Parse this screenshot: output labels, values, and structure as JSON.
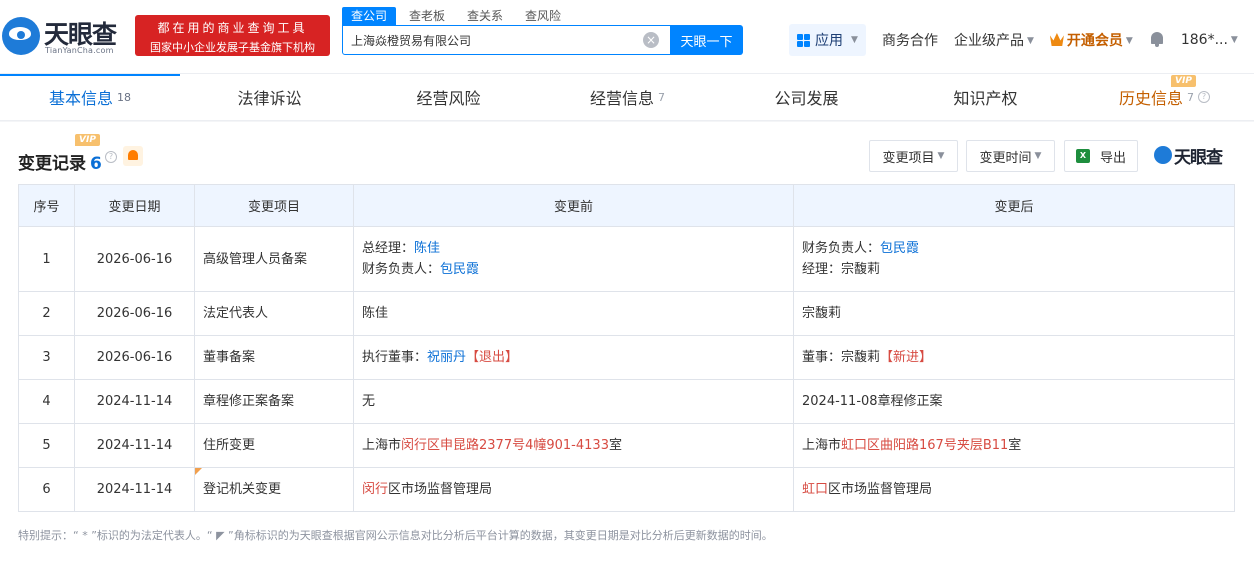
{
  "header": {
    "logo_name": "天眼查",
    "logo_domain": "TianYanCha.com",
    "slogan_line1": "都在用的商业查询工具",
    "slogan_line2": "国家中小企业发展子基金旗下机构",
    "search_tabs": [
      "查公司",
      "查老板",
      "查关系",
      "查风险"
    ],
    "search_value": "上海焱橙贸易有限公司",
    "search_button": "天眼一下",
    "nav": {
      "apps": "应用",
      "business": "商务合作",
      "enterprise": "企业级产品",
      "vip": "开通会员",
      "user": "186*..."
    }
  },
  "tabs": [
    {
      "label": "基本信息",
      "count": "18"
    },
    {
      "label": "法律诉讼",
      "count": ""
    },
    {
      "label": "经营风险",
      "count": ""
    },
    {
      "label": "经营信息",
      "count": "7"
    },
    {
      "label": "公司发展",
      "count": ""
    },
    {
      "label": "知识产权",
      "count": ""
    },
    {
      "label": "历史信息",
      "count": "7"
    }
  ],
  "badges": {
    "vip": "VIP"
  },
  "section": {
    "title": "变更记录",
    "count": "6",
    "filter_project": "变更项目",
    "filter_time": "变更时间",
    "export": "导出",
    "brand": "天眼查"
  },
  "table": {
    "headers": [
      "序号",
      "变更日期",
      "变更项目",
      "变更前",
      "变更后"
    ],
    "rows": [
      {
        "index": "1",
        "date": "2026-06-16",
        "item": "高级管理人员备案",
        "before": {
          "line1_label": "总经理：",
          "line1_value": "陈佳",
          "line2_label": "财务负责人：",
          "line2_value": "包民霞"
        },
        "after": {
          "line1_label": "财务负责人：",
          "line1_value": "包民霞",
          "line2_label": "经理：",
          "line2_value": "宗馥莉"
        }
      },
      {
        "index": "2",
        "date": "2026-06-16",
        "item": "法定代表人",
        "before": "陈佳",
        "after": "宗馥莉"
      },
      {
        "index": "3",
        "date": "2026-06-16",
        "item": "董事备案",
        "before": {
          "label": "执行董事：",
          "name": "祝丽丹",
          "status": "【退出】"
        },
        "after": {
          "label": "董事：",
          "name": "宗馥莉",
          "status": "【新进】"
        }
      },
      {
        "index": "4",
        "date": "2024-11-14",
        "item": "章程修正案备案",
        "before": "无",
        "after": "2024-11-08章程修正案"
      },
      {
        "index": "5",
        "date": "2024-11-14",
        "item": "住所变更",
        "before": {
          "prefix": "上海市",
          "changed": "闵行区申昆路2377号4幢901-4133",
          "suffix": "室"
        },
        "after": {
          "prefix": "上海市",
          "changed": "虹口区曲阳路167号夹层B11",
          "suffix": "室"
        }
      },
      {
        "index": "6",
        "date": "2024-11-14",
        "item": "登记机关变更",
        "before": {
          "changed": "闵行",
          "suffix": "区市场监督管理局"
        },
        "after": {
          "changed": "虹口",
          "suffix": "区市场监督管理局"
        }
      }
    ]
  },
  "footer_note": "特别提示：“ * ”标识的为法定代表人。“ ◤ ”角标标识的为天眼查根据官网公示信息对比分析后平台计算的数据，其变更日期是对比分析后更新数据的时间。"
}
